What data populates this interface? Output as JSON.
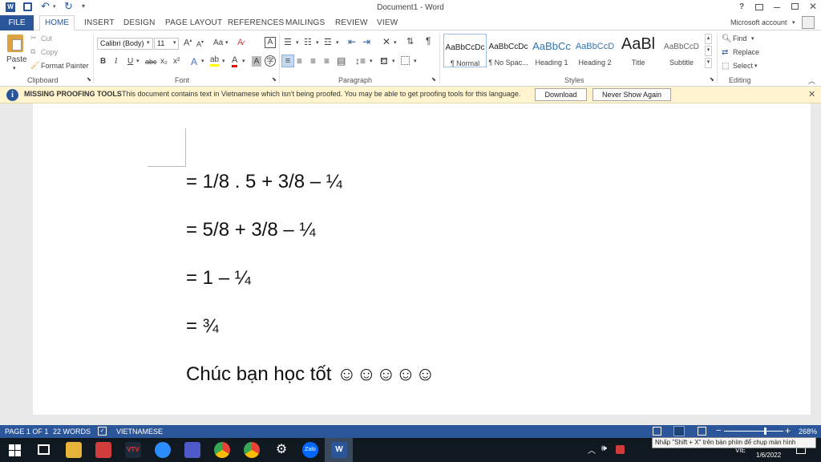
{
  "titlebar": {
    "title": "Document1 - Word",
    "help": "?",
    "account": "Microsoft account"
  },
  "tabs": {
    "file": "FILE",
    "home": "HOME",
    "insert": "INSERT",
    "design": "DESIGN",
    "page_layout": "PAGE LAYOUT",
    "references": "REFERENCES",
    "mailings": "MAILINGS",
    "review": "REVIEW",
    "view": "VIEW"
  },
  "clipboard": {
    "paste": "Paste",
    "cut": "Cut",
    "copy": "Copy",
    "format_painter": "Format Painter",
    "label": "Clipboard"
  },
  "font": {
    "name": "Calibri (Body)",
    "size": "11",
    "label": "Font",
    "bold": "B",
    "italic": "I",
    "underline": "U",
    "strike": "abc",
    "sub": "x₂",
    "sup": "x²",
    "case": "Aa"
  },
  "paragraph": {
    "label": "Paragraph"
  },
  "styles": {
    "label": "Styles",
    "items": [
      {
        "sample": "AaBbCcDc",
        "name": "¶ Normal"
      },
      {
        "sample": "AaBbCcDc",
        "name": "¶ No Spac..."
      },
      {
        "sample": "AaBbCc",
        "name": "Heading 1"
      },
      {
        "sample": "AaBbCcD",
        "name": "Heading 2"
      },
      {
        "sample": "AaBl",
        "name": "Title"
      },
      {
        "sample": "AaBbCcD",
        "name": "Subtitle"
      }
    ]
  },
  "editing": {
    "find": "Find",
    "replace": "Replace",
    "select": "Select",
    "label": "Editing"
  },
  "infobar": {
    "title": "MISSING PROOFING TOOLS",
    "message": "This document contains text in Vietnamese which isn't being proofed. You may be able to get proofing tools for this language.",
    "download": "Download",
    "never_show": "Never Show Again"
  },
  "document": {
    "lines": [
      "= 1/8 . 5 + 3/8 – ¼",
      "= 5/8 + 3/8 – ¼",
      "= 1 – ¼",
      "= ¾",
      "Chúc bạn học tốt ☺☺☺☺☺"
    ]
  },
  "status": {
    "page": "PAGE 1 OF 1",
    "words": "22 WORDS",
    "language": "VIETNAMESE",
    "zoom": "268%"
  },
  "taskbar": {
    "lang": "VIE",
    "date": "1/6/2022",
    "tooltip": "Nhấp \"Shift + X\" trên bàn phím để chụp màn hình",
    "zalo": "Zalo"
  }
}
